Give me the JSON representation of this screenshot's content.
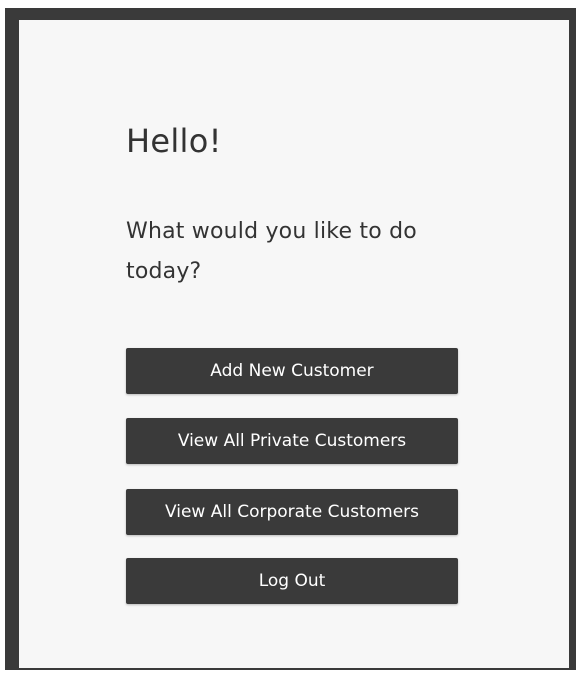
{
  "header": {
    "greeting": "Hello!",
    "prompt": "What would you like to do today?"
  },
  "actions": [
    {
      "label": "Add New Customer"
    },
    {
      "label": "View All Private Customers"
    },
    {
      "label": "View All Corporate Customers"
    },
    {
      "label": "Log Out"
    }
  ],
  "colors": {
    "frame": "#3a3a3a",
    "panel_background": "#f7f7f7",
    "button_background": "#3a3a3a",
    "button_text": "#ffffff",
    "text": "#333333"
  }
}
